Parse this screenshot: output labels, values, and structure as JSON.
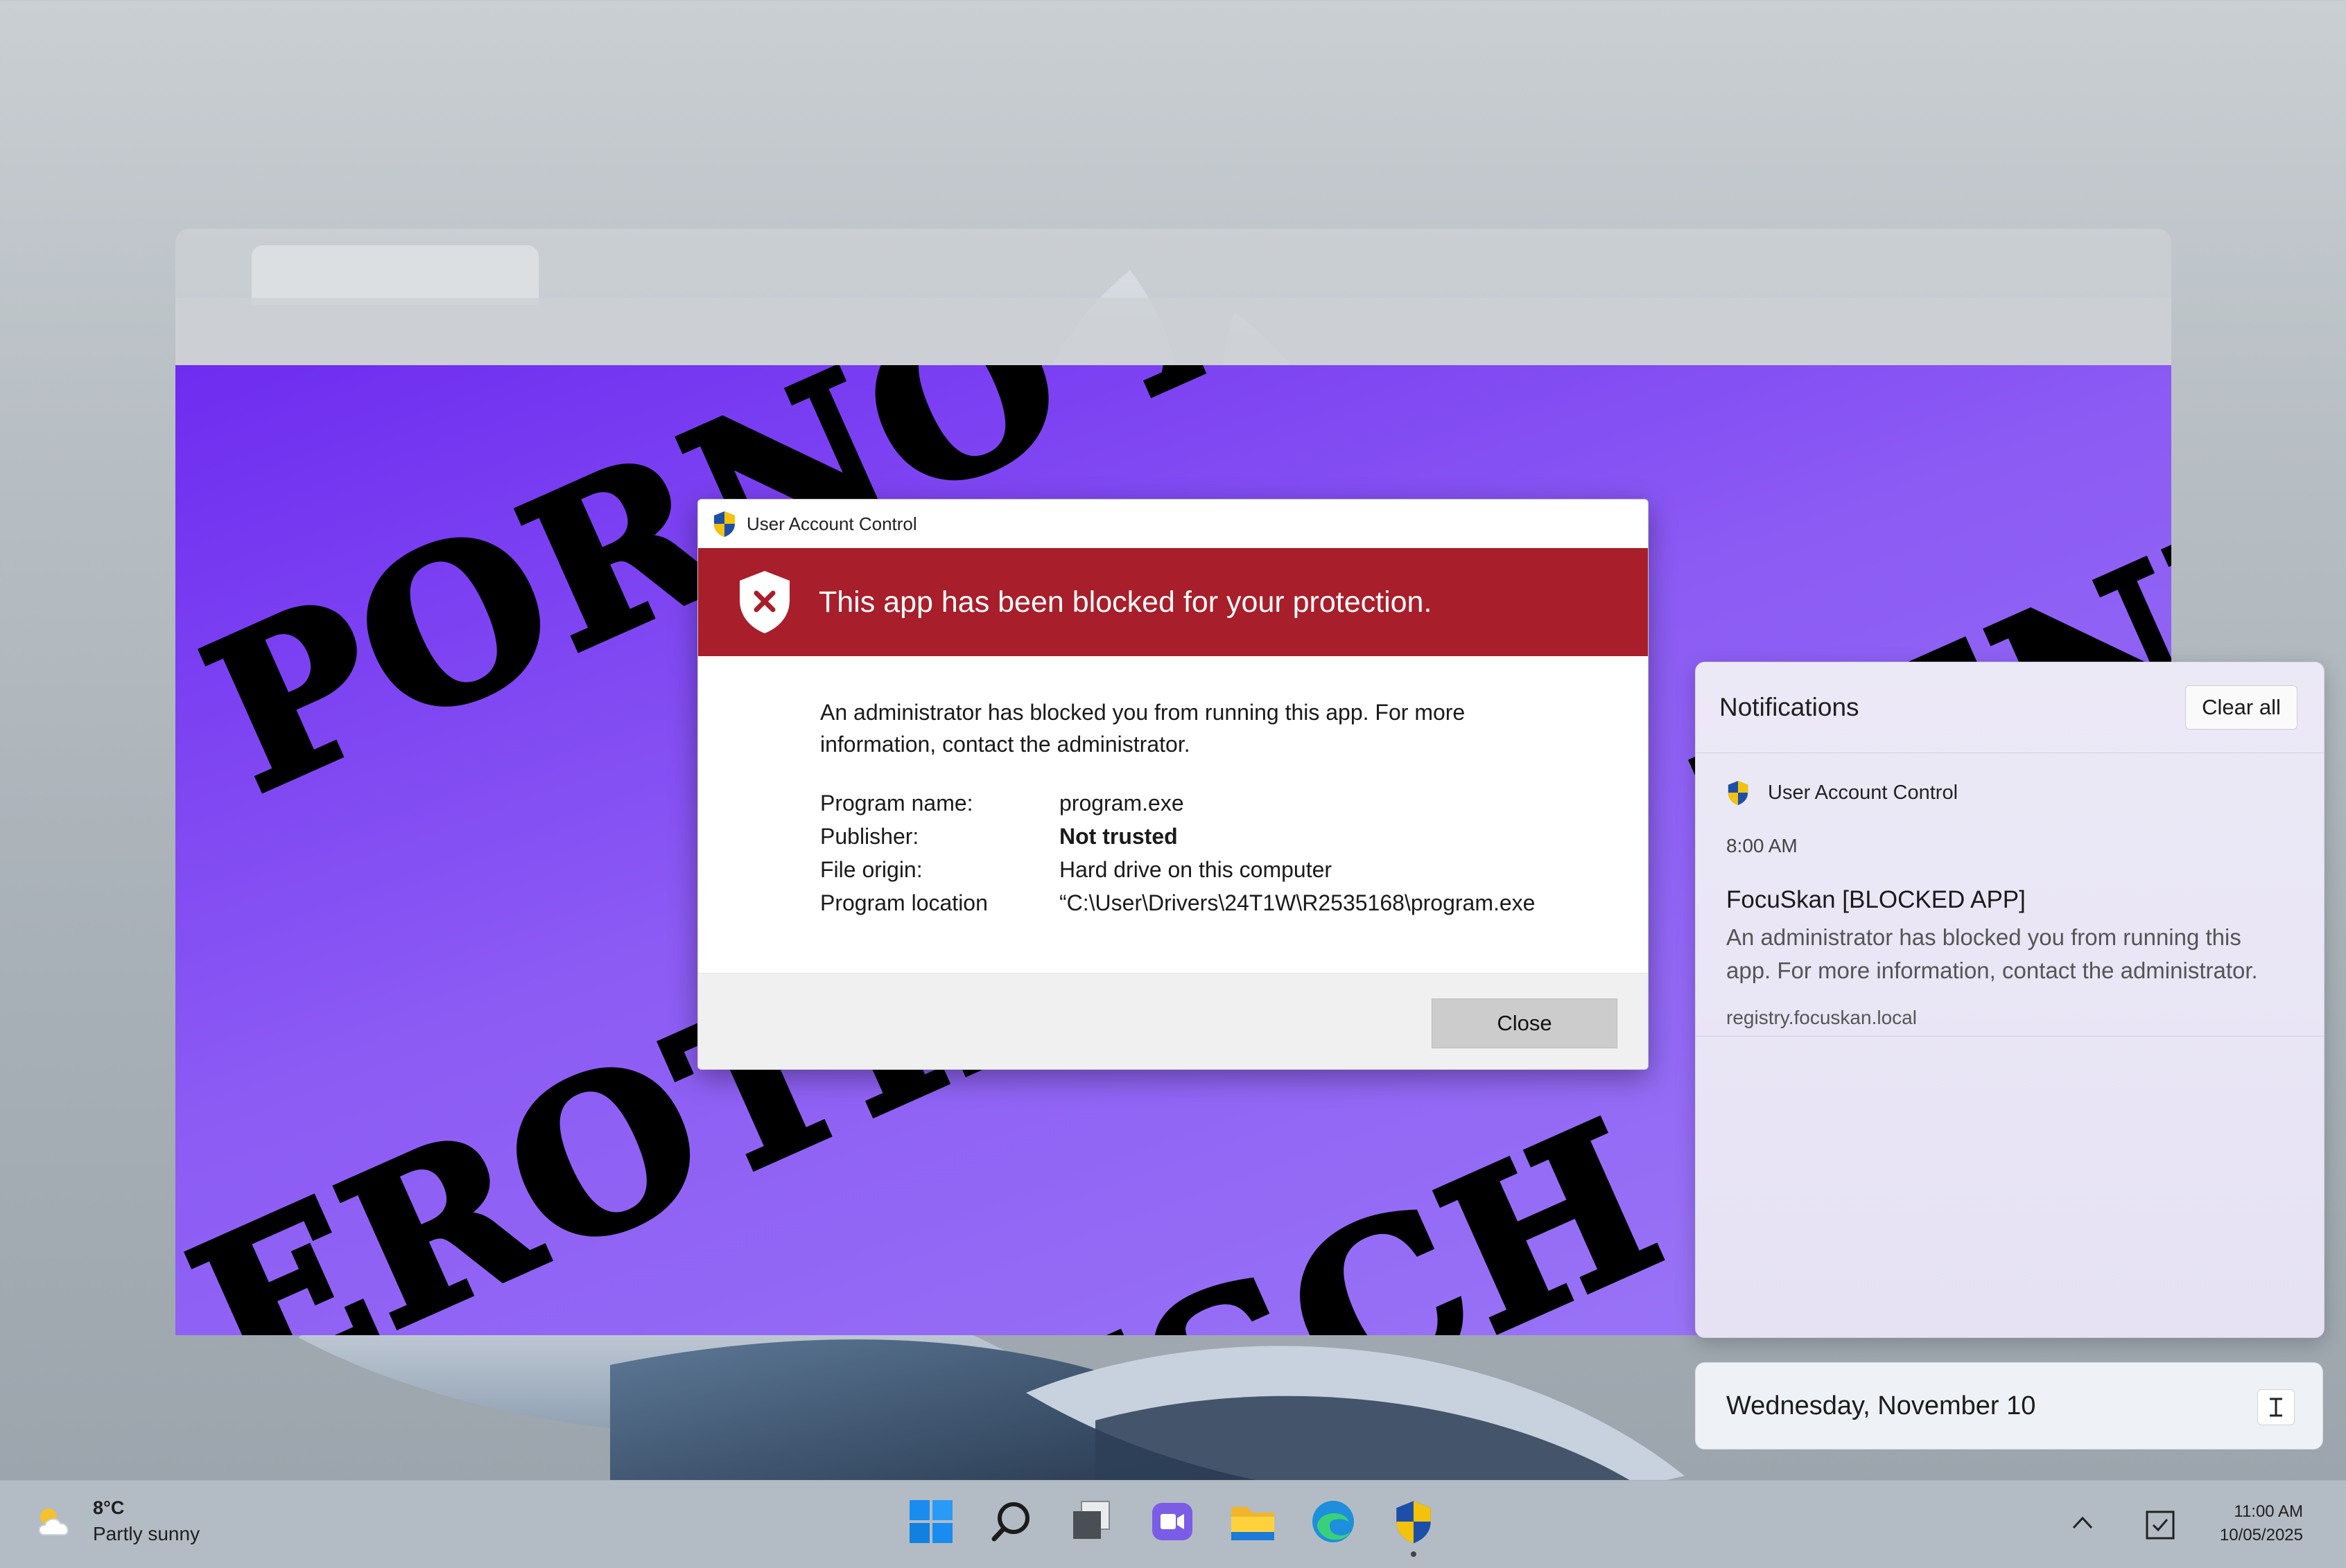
{
  "browser": {
    "background_words": [
      "PORNO XX",
      "PENI",
      "EROTIK",
      "FISCH"
    ]
  },
  "uac": {
    "window_title": "User Account Control",
    "banner_text": "This app has been blocked for your protection.",
    "description": "An administrator has blocked you from running this app. For more information, contact the administrator.",
    "details": [
      {
        "label": "Program name:",
        "value": "program.exe",
        "bold": false
      },
      {
        "label": "Publisher:",
        "value": "Not trusted",
        "bold": true
      },
      {
        "label": "File origin:",
        "value": "Hard drive on this computer",
        "bold": false
      },
      {
        "label": "Program location",
        "value": "“C:\\User\\Drivers\\24T1W\\R2535168\\program.exe",
        "bold": false
      }
    ],
    "close_label": "Close",
    "banner_color": "#a81e2a"
  },
  "notifications": {
    "header": "Notifications",
    "clear_all_label": "Clear all",
    "items": [
      {
        "app": "User Account Control",
        "time": "8:00 AM",
        "title": "FocuSkan [BLOCKED APP]",
        "body": "An administrator has blocked you from running this app. For more information, contact the administrator.",
        "source": "registry.focuskan.local"
      }
    ]
  },
  "calendar": {
    "date": "Wednesday, November 10",
    "icon": "calendar-icon"
  },
  "taskbar": {
    "weather": {
      "temp": "8°C",
      "condition": "Partly sunny",
      "icon": "partly-sunny-icon"
    },
    "icons": [
      "start-icon",
      "search-icon",
      "task-view-icon",
      "chat-icon",
      "file-explorer-icon",
      "edge-icon",
      "security-shield-icon"
    ],
    "tray": [
      "chevron-up-icon",
      "checkbox-icon"
    ],
    "clock": {
      "time": "11:00 AM",
      "date": "10/05/2025"
    }
  }
}
